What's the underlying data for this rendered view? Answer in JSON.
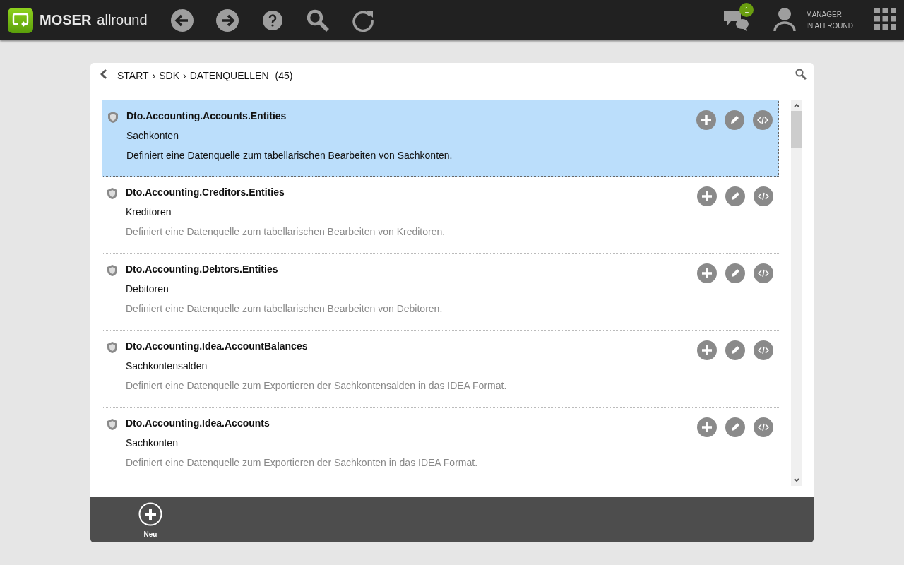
{
  "topbar": {
    "brand_bold": "MOSER",
    "brand_light": "allround",
    "messages_badge": "1",
    "user_line1": "MANAGER",
    "user_line2": "IN ALLROUND"
  },
  "breadcrumb": {
    "items": [
      "START",
      "SDK",
      "DATENQUELLEN"
    ],
    "separator": "›",
    "count": "(45)"
  },
  "rows": [
    {
      "name": "Dto.Accounting.Accounts.Entities",
      "title": "Sachkonten",
      "description": "Definiert eine Datenquelle zum tabellarischen Bearbeiten von Sachkonten.",
      "selected": true
    },
    {
      "name": "Dto.Accounting.Creditors.Entities",
      "title": "Kreditoren",
      "description": "Definiert eine Datenquelle zum tabellarischen Bearbeiten von Kreditoren.",
      "selected": false
    },
    {
      "name": "Dto.Accounting.Debtors.Entities",
      "title": "Debitoren",
      "description": "Definiert eine Datenquelle zum tabellarischen Bearbeiten von Debitoren.",
      "selected": false
    },
    {
      "name": "Dto.Accounting.Idea.AccountBalances",
      "title": "Sachkontensalden",
      "description": "Definiert eine Datenquelle zum Exportieren der Sachkontensalden in das IDEA Format.",
      "selected": false
    },
    {
      "name": "Dto.Accounting.Idea.Accounts",
      "title": "Sachkonten",
      "description": "Definiert eine Datenquelle zum Exportieren der Sachkonten in das IDEA Format.",
      "selected": false
    }
  ],
  "footer": {
    "new_label": "Neu"
  }
}
